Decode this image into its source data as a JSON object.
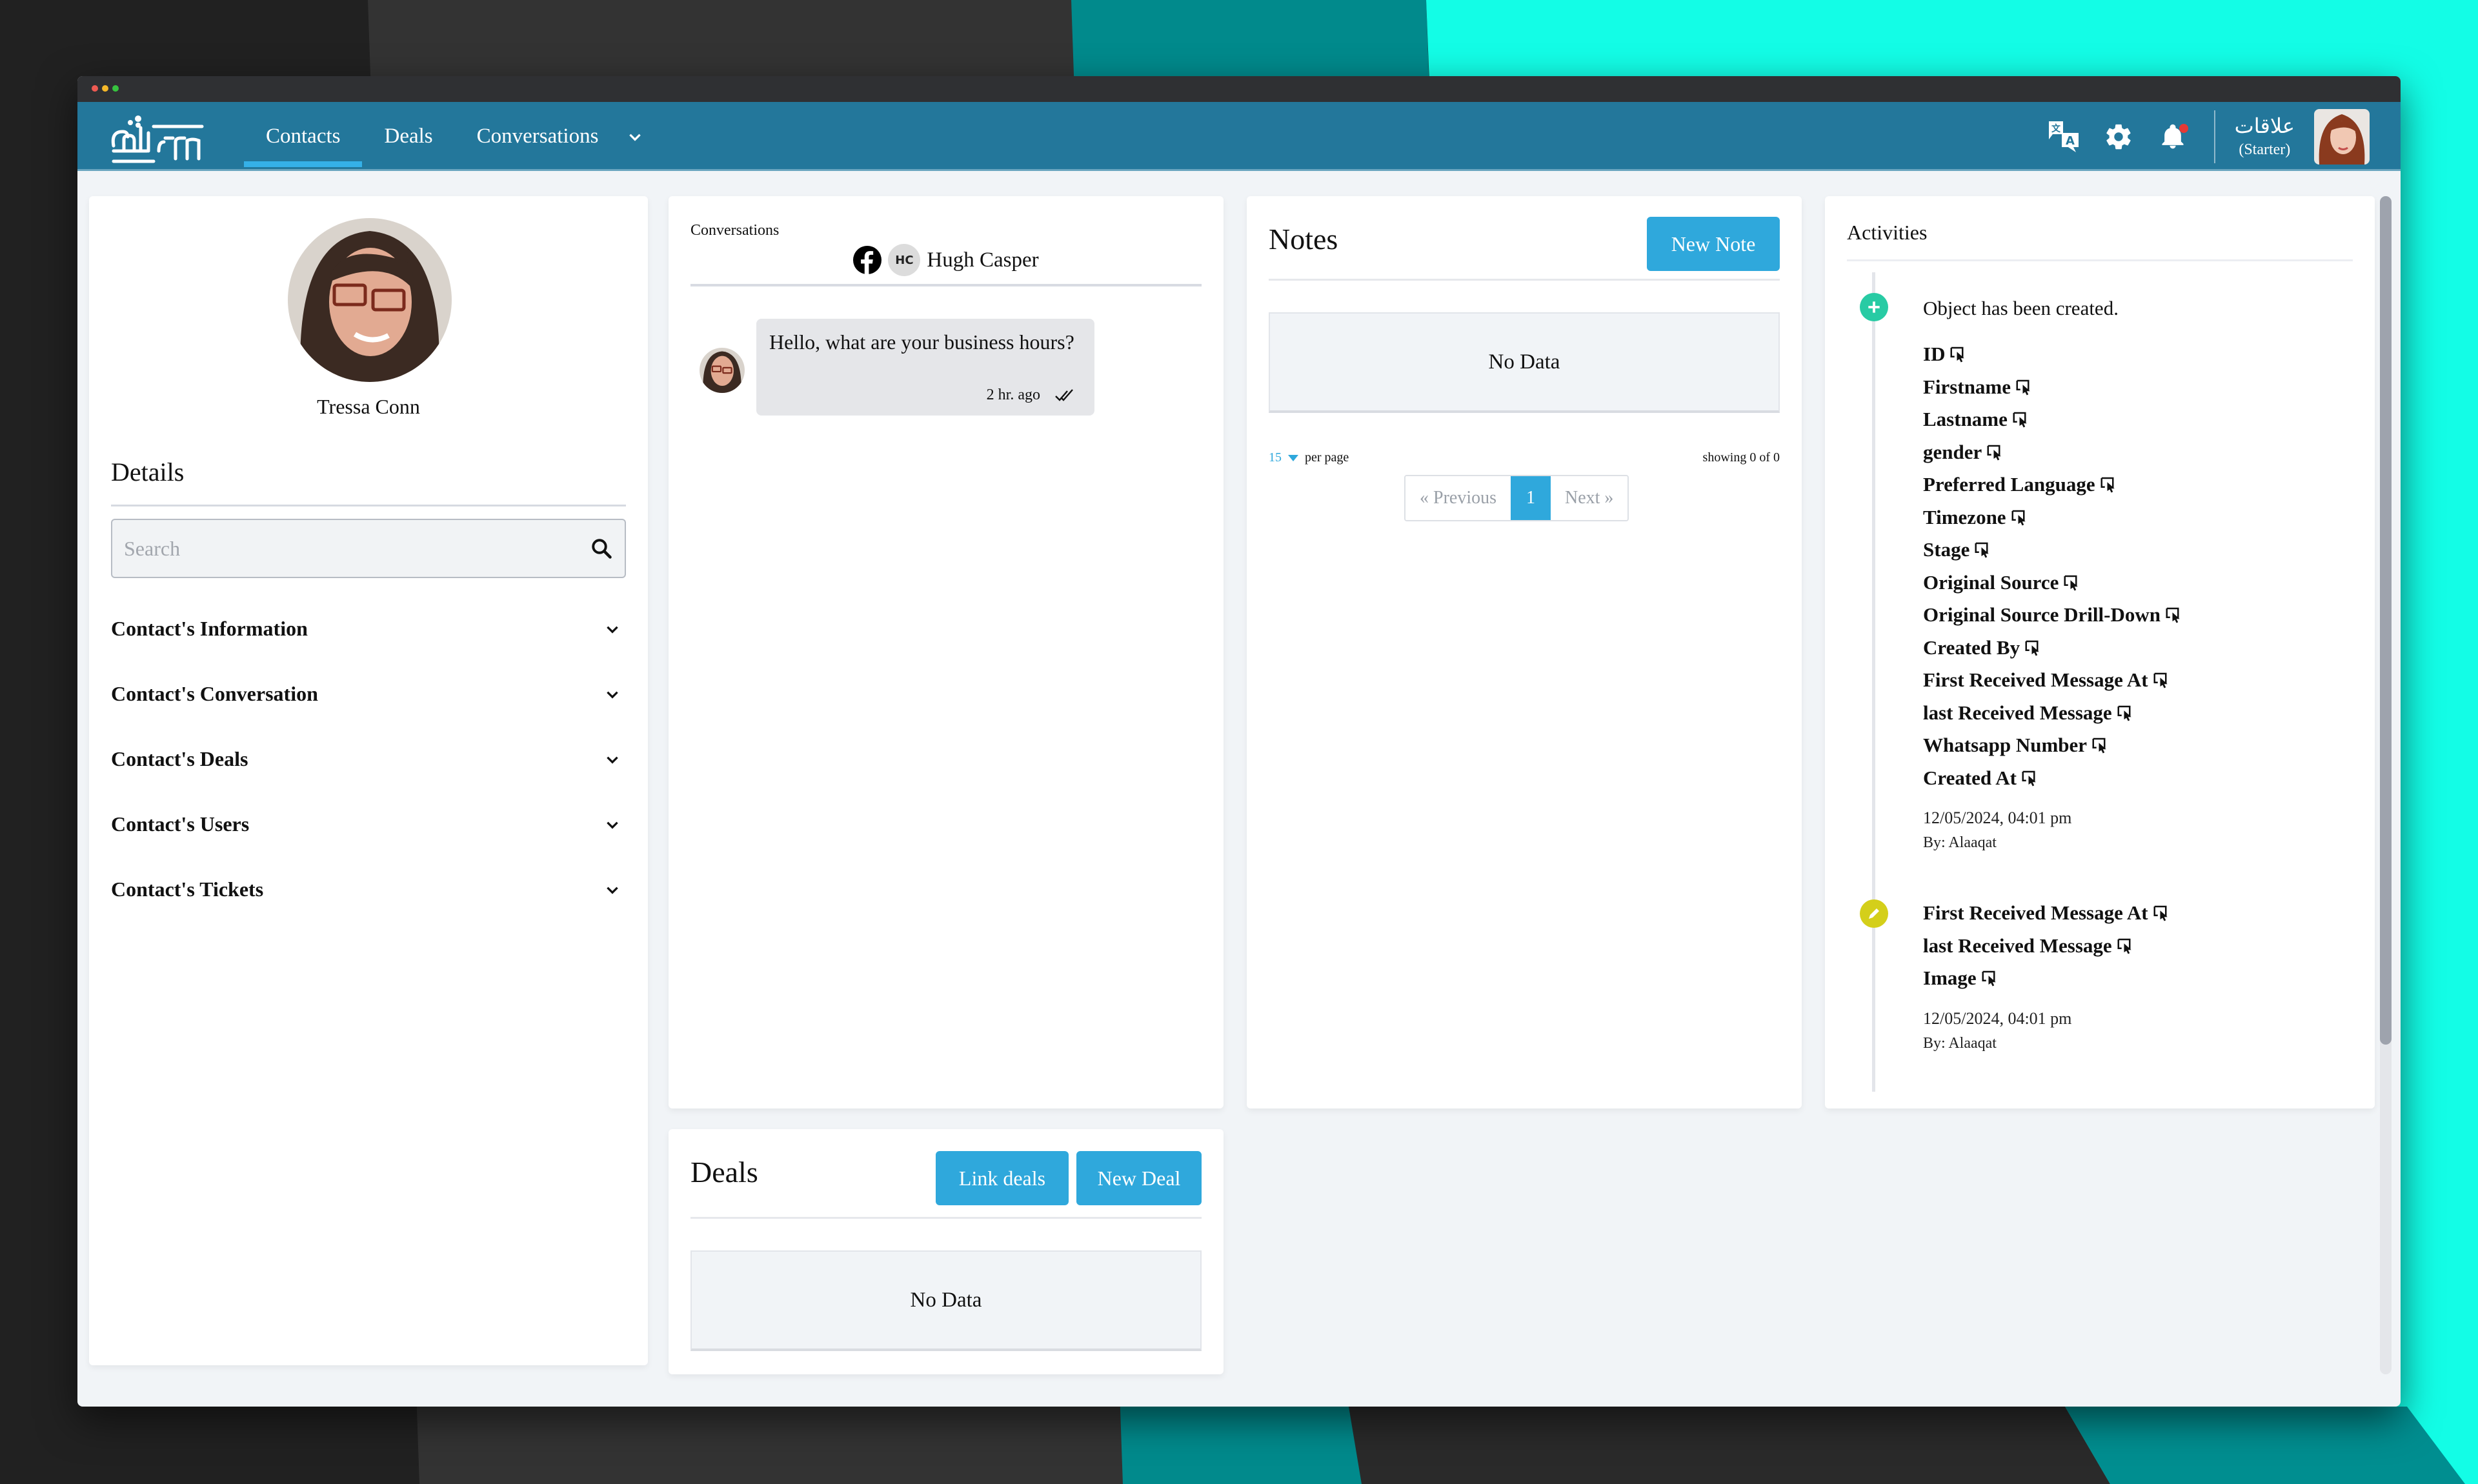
{
  "window": {
    "traffic_lights": [
      "close",
      "minimize",
      "maximize"
    ]
  },
  "navbar": {
    "logo_alt": "علاقات logo",
    "tabs": [
      {
        "label": "Contacts",
        "active": true
      },
      {
        "label": "Deals",
        "active": false
      },
      {
        "label": "Conversations",
        "active": false
      }
    ],
    "more_icon": "chevron-down-icon",
    "icons": [
      "translate-icon",
      "gear-icon",
      "bell-icon"
    ],
    "has_notification": true,
    "user": {
      "name": "علاقات",
      "plan": "(Starter)"
    }
  },
  "profile": {
    "name": "Tressa Conn",
    "details_title": "Details",
    "search_placeholder": "Search",
    "sections": [
      "Contact's Information",
      "Contact's Conversation",
      "Contact's Deals",
      "Contact's Users",
      "Contact's Tickets"
    ]
  },
  "conversations": {
    "label": "Conversations",
    "channel_icon": "facebook-icon",
    "contact_initials": "HC",
    "contact_name": "Hugh Casper",
    "messages": [
      {
        "text": "Hello, what are your business hours?",
        "time": "2 hr. ago",
        "status": "read"
      }
    ]
  },
  "deals": {
    "title": "Deals",
    "link_button": "Link deals",
    "new_button": "New Deal",
    "empty_text": "No Data"
  },
  "notes": {
    "title": "Notes",
    "new_button": "New Note",
    "empty_text": "No Data",
    "per_page_value": "15",
    "per_page_label": "per page",
    "showing": "showing 0 of 0",
    "pagination": {
      "prev": "« Previous",
      "current": "1",
      "next": "Next »"
    }
  },
  "activities": {
    "title": "Activities",
    "entries": [
      {
        "type": "create",
        "heading": "Object has been created.",
        "fields": [
          "ID",
          "Firstname",
          "Lastname",
          "gender",
          "Preferred Language",
          "Timezone",
          "Stage",
          "Original Source",
          "Original Source Drill-Down",
          "Created By",
          "First Received Message At",
          "last Received Message",
          "Whatsapp Number",
          "Created At"
        ],
        "date": "12/05/2024, 04:01 pm",
        "by": "By: Alaaqat"
      },
      {
        "type": "edit",
        "heading": "",
        "fields": [
          "First Received Message At",
          "last Received Message",
          "Image"
        ],
        "date": "12/05/2024, 04:01 pm",
        "by": "By: Alaaqat"
      }
    ]
  },
  "colors": {
    "navbar": "#23779b",
    "accent": "#2fa8dc",
    "create_dot": "#28cba4",
    "edit_dot": "#d4cf1a",
    "notification": "#e53935"
  },
  "scroll": {
    "visible_fraction": 0.72
  }
}
